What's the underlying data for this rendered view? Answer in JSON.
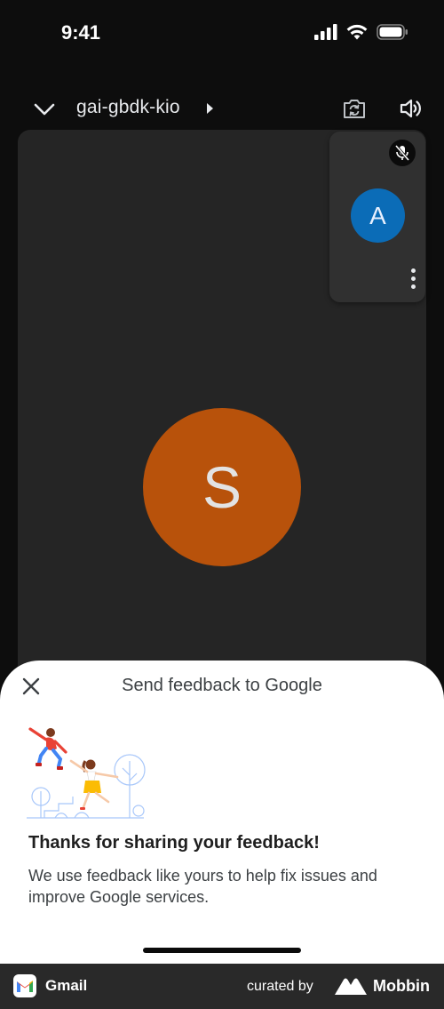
{
  "status_bar": {
    "time": "9:41",
    "icons": [
      "signal-icon",
      "wifi-icon",
      "battery-icon"
    ]
  },
  "call_header": {
    "meeting_code": "gai-gbdk-kio",
    "icons": [
      "chevron-down-icon",
      "caret-right-icon",
      "camera-switch-icon",
      "speaker-icon"
    ]
  },
  "main_participant": {
    "initial": "S",
    "avatar_color": "#b8520b"
  },
  "self_view": {
    "initial": "A",
    "avatar_color": "#0b6cb7",
    "muted": true,
    "icons": [
      "mic-off-icon",
      "more-vert-icon"
    ]
  },
  "feedback_sheet": {
    "title": "Send feedback to Google",
    "heading": "Thanks for sharing your feedback!",
    "body": "We use feedback like yours to help fix issues and improve Google services.",
    "icons": [
      "close-icon"
    ]
  },
  "bottom_bar": {
    "app_name": "Gmail",
    "curated_by": "curated by",
    "brand": "Mobbin"
  },
  "colors": {
    "background": "#0d0d0d",
    "tile": "#252525",
    "sheet": "#ffffff"
  }
}
